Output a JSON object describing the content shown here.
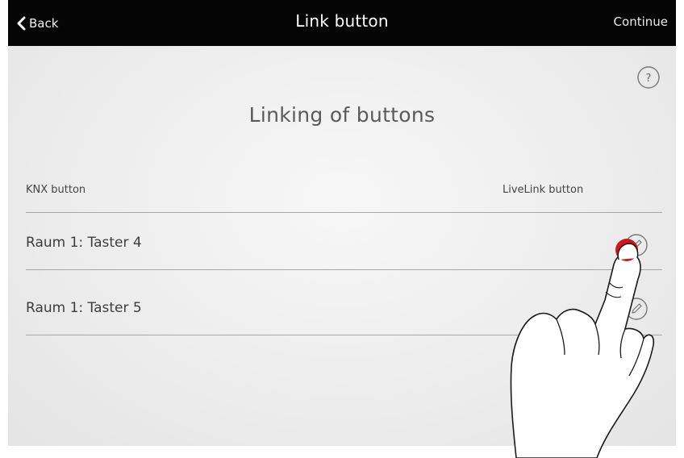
{
  "header": {
    "back_label": "Back",
    "title": "Link button",
    "continue_label": "Continue"
  },
  "help": {
    "icon": "question-circle-icon",
    "label": "?"
  },
  "main": {
    "heading": "Linking of buttons",
    "columns": {
      "left": "KNX button",
      "right": "LiveLink button"
    },
    "rows": [
      {
        "label": "Raum 1: Taster 4",
        "action_icon": "edit-pencil-icon"
      },
      {
        "label": "Raum 1: Taster 5",
        "action_icon": "edit-pencil-icon"
      }
    ]
  },
  "colors": {
    "topbar": "#050505",
    "background": "#ececec",
    "touch_indicator": "#d4141c"
  }
}
